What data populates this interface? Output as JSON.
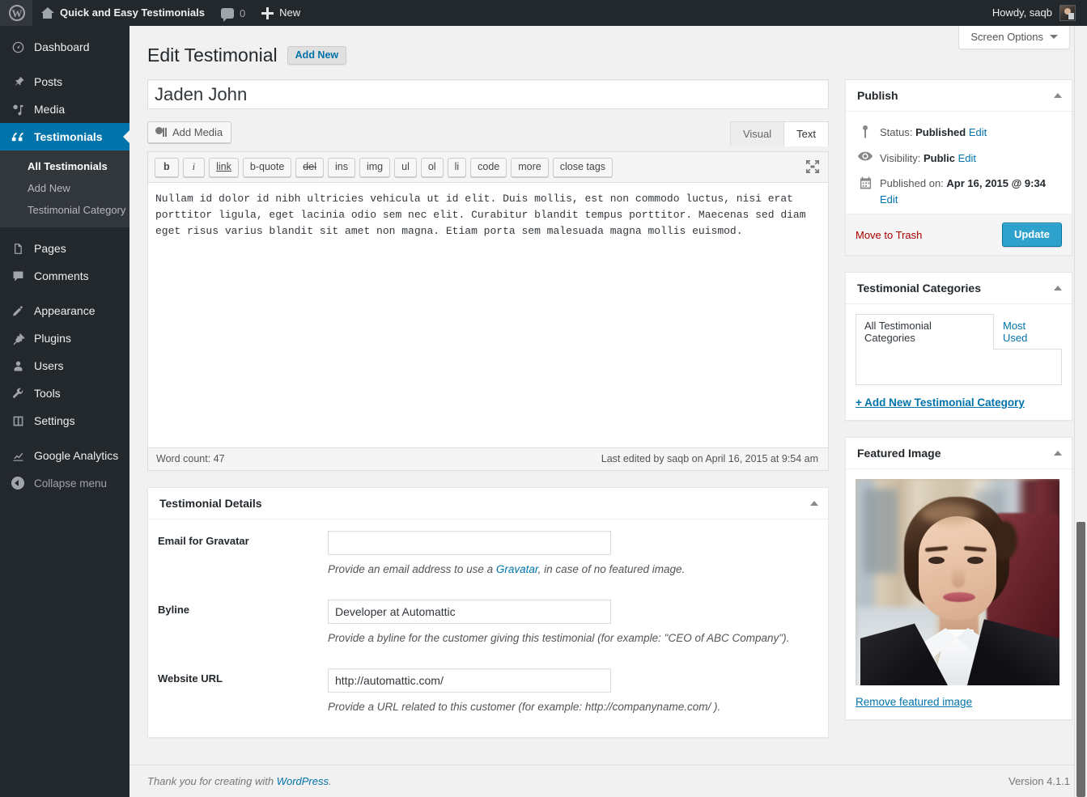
{
  "adminbar": {
    "wp_logo": "W",
    "site_name": "Quick and Easy Testimonials",
    "comments_count": "0",
    "new_label": "New",
    "howdy": "Howdy, saqb"
  },
  "sidebar": {
    "items": [
      {
        "label": "Dashboard",
        "icon": "dashboard-icon",
        "current": false
      },
      {
        "label": "Posts",
        "icon": "pin-icon",
        "current": false
      },
      {
        "label": "Media",
        "icon": "media-icon",
        "current": false
      },
      {
        "label": "Testimonials",
        "icon": "quote-icon",
        "current": true
      },
      {
        "label": "Pages",
        "icon": "page-icon",
        "current": false
      },
      {
        "label": "Comments",
        "icon": "comment-icon",
        "current": false
      },
      {
        "label": "Appearance",
        "icon": "brush-icon",
        "current": false
      },
      {
        "label": "Plugins",
        "icon": "plug-icon",
        "current": false
      },
      {
        "label": "Users",
        "icon": "user-icon",
        "current": false
      },
      {
        "label": "Tools",
        "icon": "wrench-icon",
        "current": false
      },
      {
        "label": "Settings",
        "icon": "settings-icon",
        "current": false
      },
      {
        "label": "Google Analytics",
        "icon": "analytics-icon",
        "current": false
      }
    ],
    "submenu": [
      {
        "label": "All Testimonials",
        "current": true
      },
      {
        "label": "Add New",
        "current": false
      },
      {
        "label": "Testimonial Category",
        "current": false
      }
    ],
    "collapse_label": "Collapse menu"
  },
  "screen_options": {
    "label": "Screen Options"
  },
  "page": {
    "title": "Edit Testimonial",
    "add_new_label": "Add New"
  },
  "post": {
    "title_value": "Jaden John",
    "content": "Nullam id dolor id nibh ultricies vehicula ut id elit. Duis mollis, est non commodo luctus, nisi erat porttitor ligula, eget lacinia odio sem nec elit. Curabitur blandit tempus porttitor. Maecenas sed diam eget risus varius blandit sit amet non magna. Etiam porta sem malesuada magna mollis euismod."
  },
  "editor": {
    "add_media_label": "Add Media",
    "tab_visual": "Visual",
    "tab_text": "Text",
    "active_tab": "Text",
    "quicktags": [
      "b",
      "i",
      "link",
      "b-quote",
      "del",
      "ins",
      "img",
      "ul",
      "ol",
      "li",
      "code",
      "more",
      "close tags"
    ],
    "word_count": "Word count: 47",
    "last_edited": "Last edited by saqb on April 16, 2015 at 9:54 am"
  },
  "testimonial_details": {
    "panel_title": "Testimonial Details",
    "fields": [
      {
        "label": "Email for Gravatar",
        "value": "",
        "desc_before": "Provide an email address to use a ",
        "desc_link": "Gravatar",
        "desc_after": ", in case of no featured image."
      },
      {
        "label": "Byline",
        "value": "Developer at Automattic",
        "desc_before": "Provide a byline for the customer giving this testimonial (for example: \"CEO of ABC Company\").",
        "desc_link": "",
        "desc_after": ""
      },
      {
        "label": "Website URL",
        "value": "http://automattic.com/",
        "desc_before": "Provide a URL related to this customer (for example: http://companyname.com/ ).",
        "desc_link": "",
        "desc_after": ""
      }
    ]
  },
  "publish": {
    "panel_title": "Publish",
    "status_label": "Status:",
    "status_value": "Published",
    "status_edit": "Edit",
    "visibility_label": "Visibility:",
    "visibility_value": "Public",
    "visibility_edit": "Edit",
    "published_label": "Published on:",
    "published_value": "Apr 16, 2015 @ 9:34",
    "published_edit": "Edit",
    "trash_label": "Move to Trash",
    "update_label": "Update"
  },
  "categories": {
    "panel_title": "Testimonial Categories",
    "tab_all": "All Testimonial Categories",
    "tab_most_used": "Most Used",
    "active_tab": "All Testimonial Categories",
    "add_new_label": "+ Add New Testimonial Category"
  },
  "featured_image": {
    "panel_title": "Featured Image",
    "remove_label": "Remove featured image",
    "alt": "professional-headshot-woman-dark-blazer"
  },
  "footer": {
    "thankyou_before": "Thank you for creating with ",
    "thankyou_link": "WordPress",
    "thankyou_after": ".",
    "version": "Version 4.1.1"
  },
  "colors": {
    "admin_bg": "#23282d",
    "accent": "#0073aa",
    "button": "#2ea2cc",
    "danger": "#a00",
    "page_bg": "#f1f1f1"
  }
}
